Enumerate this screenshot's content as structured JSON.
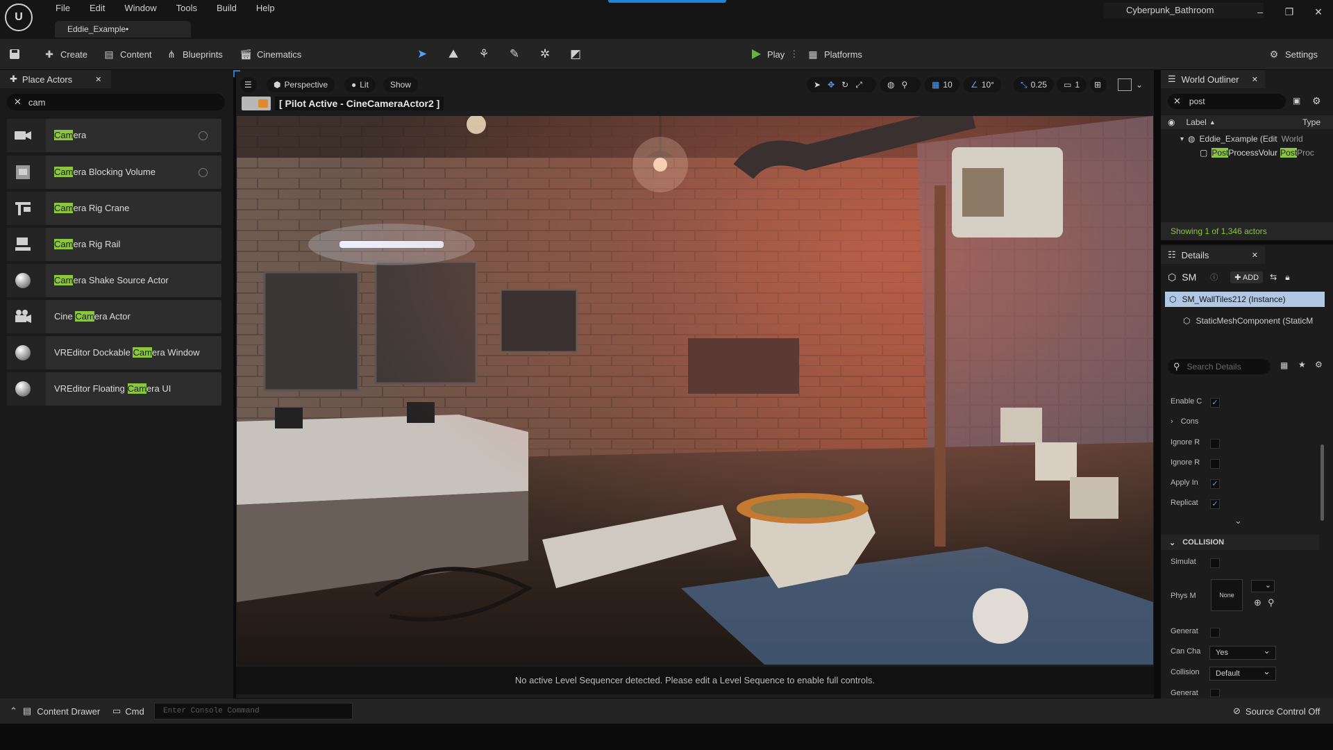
{
  "app": {
    "menu": [
      "File",
      "Edit",
      "Window",
      "Tools",
      "Build",
      "Help"
    ],
    "doc_tab": "Eddie_Example•",
    "project_name": "Cyberpunk_Bathroom",
    "window_controls": [
      "minimize-icon",
      "restore-icon",
      "close-icon"
    ]
  },
  "toolbar": {
    "create": "Create",
    "content": "Content",
    "blueprints": "Blueprints",
    "cinematics": "Cinematics",
    "play": "Play",
    "platforms": "Platforms",
    "settings": "Settings",
    "play_color": "#5fb83a"
  },
  "place_actors": {
    "tab_title": "Place Actors",
    "search_value": "cam",
    "highlight_color": "#8cc63f",
    "items": [
      {
        "pre": "",
        "hl": "Cam",
        "post": "era",
        "icon": "camera-icon"
      },
      {
        "pre": "",
        "hl": "Cam",
        "post": "era Blocking Volume",
        "icon": "volume-icon"
      },
      {
        "pre": "",
        "hl": "Cam",
        "post": "era Rig Crane",
        "icon": "crane-icon"
      },
      {
        "pre": "",
        "hl": "Cam",
        "post": "era Rig Rail",
        "icon": "rail-icon"
      },
      {
        "pre": "",
        "hl": "Cam",
        "post": "era Shake Source Actor",
        "icon": "sphere-icon"
      },
      {
        "pre": "Cine ",
        "hl": "Cam",
        "post": "era Actor",
        "icon": "cine-camera-icon"
      },
      {
        "pre": "VREditor Dockable ",
        "hl": "Cam",
        "post": "era Window",
        "icon": "sphere-icon"
      },
      {
        "pre": "VREditor Floating ",
        "hl": "Cam",
        "post": "era UI",
        "icon": "sphere-icon"
      }
    ]
  },
  "viewport": {
    "perspective": "Perspective",
    "lit": "Lit",
    "show": "Show",
    "grid_snap": "10",
    "rotation_snap": "10°",
    "scale_snap": "0.25",
    "camera_speed": "1",
    "pilot_text": "[ Pilot Active - CineCameraActor2 ]",
    "status": "No active Level Sequencer detected. Please edit a Level Sequence to enable full controls."
  },
  "outliner": {
    "tab_title": "World Outliner",
    "search_value": "post",
    "col_label": "Label",
    "col_type": "Type",
    "row1_label": "Eddie_Example (Edit",
    "row1_type": "World",
    "row2_hl": "Post",
    "row2_rest": "ProcessVolur",
    "row2_type_hl": "Post",
    "row2_type_rest": "Proc",
    "footer": "Showing 1 of 1,346 actors"
  },
  "details": {
    "tab_title": "Details",
    "actor_short": "SM",
    "add_label": "ADD",
    "selected_component": "SM_WallTiles212 (Instance)",
    "sub_component": "StaticMeshComponent (StaticM",
    "search_placeholder": "Search Details",
    "props": [
      {
        "label": "Enable C",
        "checked": true
      },
      {
        "label": "Cons",
        "checked": null
      },
      {
        "label": "Ignore R",
        "checked": false
      },
      {
        "label": "Ignore R",
        "checked": false
      },
      {
        "label": "Apply In",
        "checked": true
      },
      {
        "label": "Replicat",
        "checked": true
      }
    ],
    "collision_header": "COLLISION",
    "simulate_label": "Simulat",
    "phys_label": "Phys M",
    "phys_thumb": "None",
    "generate_label": "Generat",
    "can_char_label": "Can Cha",
    "can_char_value": "Yes",
    "collision_label": "Collision",
    "collision_value": "Default",
    "generate2_label": "Generat"
  },
  "bottom": {
    "content_drawer": "Content Drawer",
    "cmd": "Cmd",
    "console_placeholder": "Enter Console Command",
    "source_control": "Source Control Off"
  }
}
